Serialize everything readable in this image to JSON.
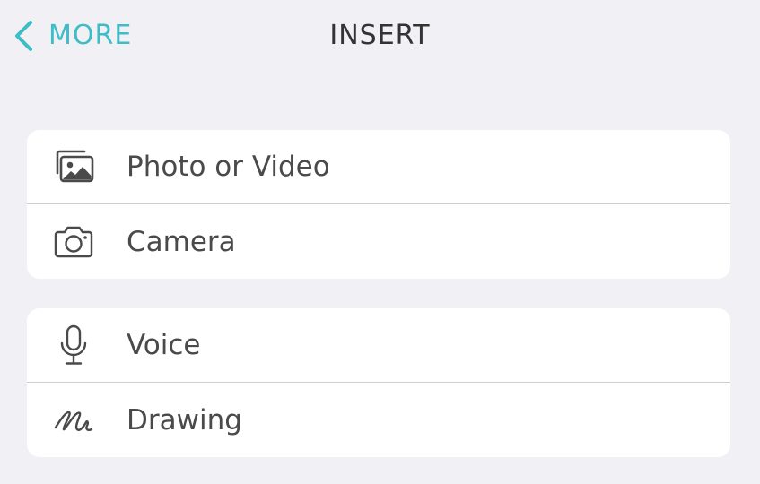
{
  "navbar": {
    "back_label": "MORE",
    "title": "INSERT"
  },
  "groups": [
    {
      "items": [
        {
          "label": "Photo or Video",
          "icon": "photo-library-icon"
        },
        {
          "label": "Camera",
          "icon": "camera-icon"
        }
      ]
    },
    {
      "items": [
        {
          "label": "Voice",
          "icon": "microphone-icon"
        },
        {
          "label": "Drawing",
          "icon": "scribble-icon"
        }
      ]
    }
  ],
  "colors": {
    "background": "#f1f0f5",
    "accent": "#3dbdc6",
    "card": "#ffffff",
    "text": "#4a4a4a"
  }
}
